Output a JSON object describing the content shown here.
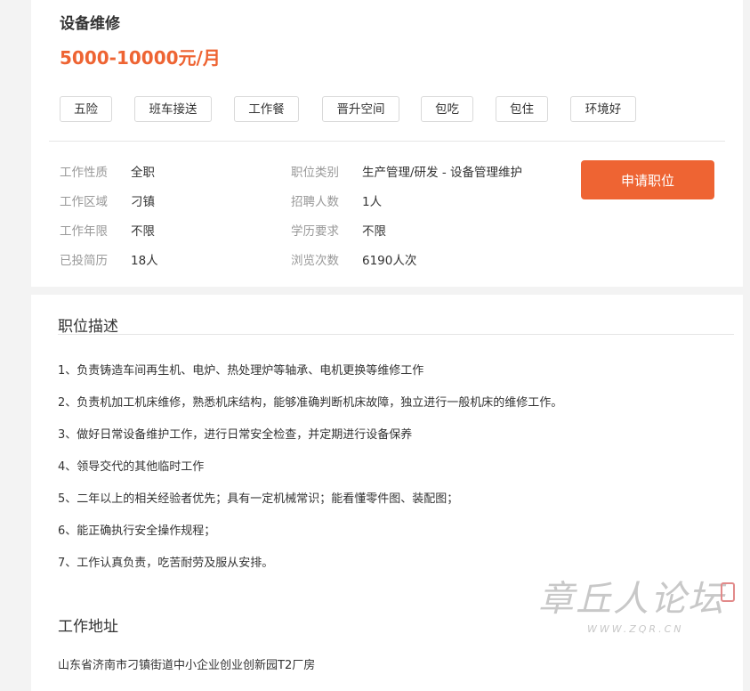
{
  "job": {
    "title": "设备维修",
    "salary": "5000-10000元/月",
    "tags": [
      "五险",
      "班车接送",
      "工作餐",
      "晋升空间",
      "包吃",
      "包住",
      "环境好"
    ],
    "info": {
      "left": [
        {
          "label": "工作性质",
          "value": "全职"
        },
        {
          "label": "工作区域",
          "value": "刁镇"
        },
        {
          "label": "工作年限",
          "value": "不限"
        },
        {
          "label": "已投简历",
          "value": "18人"
        }
      ],
      "right": [
        {
          "label": "职位类别",
          "value": "生产管理/研发 - 设备管理维护"
        },
        {
          "label": "招聘人数",
          "value": "1人"
        },
        {
          "label": "学历要求",
          "value": "不限"
        },
        {
          "label": "浏览次数",
          "value": "6190人次"
        }
      ]
    },
    "apply_label": "申请职位"
  },
  "description": {
    "title": "职位描述",
    "lines": [
      "1、负责铸造车间再生机、电炉、热处理炉等轴承、电机更换等维修工作",
      "2、负责机加工机床维修，熟悉机床结构，能够准确判断机床故障，独立进行一般机床的维修工作。",
      "3、做好日常设备维护工作，进行日常安全检查，并定期进行设备保养",
      "4、领导交代的其他临时工作",
      "5、二年以上的相关经验者优先；具有一定机械常识；能看懂零件图、装配图；",
      "6、能正确执行安全操作规程；",
      "7、工作认真负责，吃苦耐劳及服从安排。"
    ]
  },
  "address": {
    "title": "工作地址",
    "text": "山东省济南市刁镇街道中小企业创业创新园T2厂房"
  },
  "watermark": {
    "script": "章丘人论坛",
    "url": "WWW.ZQR.CN"
  },
  "colors": {
    "accent": "#ee6433",
    "label": "#999999",
    "text": "#333333",
    "border": "#d9d9d9"
  }
}
